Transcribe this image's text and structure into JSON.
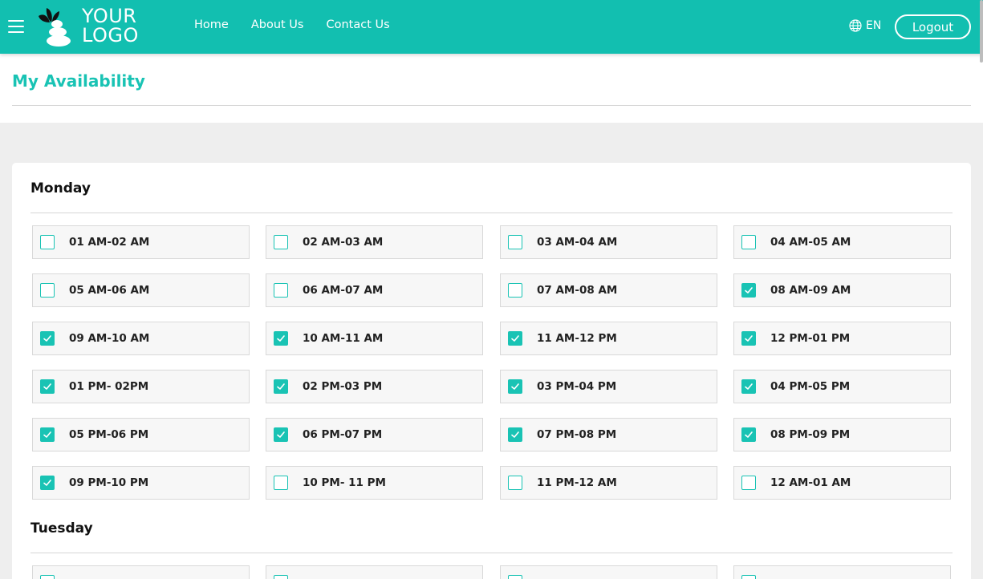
{
  "header": {
    "logo_line1": "YOUR",
    "logo_line2": "LOGO",
    "nav": [
      "Home",
      "About Us",
      "Contact Us"
    ],
    "language": "EN",
    "logout_label": "Logout",
    "brand_color": "#12bfb0"
  },
  "page": {
    "title": "My Availability"
  },
  "days": [
    {
      "name": "Monday",
      "slots": [
        {
          "label": "01 AM-02 AM",
          "checked": false
        },
        {
          "label": "02 AM-03 AM",
          "checked": false
        },
        {
          "label": "03 AM-04 AM",
          "checked": false
        },
        {
          "label": "04 AM-05 AM",
          "checked": false
        },
        {
          "label": "05 AM-06 AM",
          "checked": false
        },
        {
          "label": "06 AM-07 AM",
          "checked": false
        },
        {
          "label": "07 AM-08 AM",
          "checked": false
        },
        {
          "label": "08 AM-09 AM",
          "checked": true
        },
        {
          "label": "09 AM-10 AM",
          "checked": true
        },
        {
          "label": "10 AM-11 AM",
          "checked": true
        },
        {
          "label": "11 AM-12 PM",
          "checked": true
        },
        {
          "label": "12 PM-01 PM",
          "checked": true
        },
        {
          "label": "01 PM- 02PM",
          "checked": true
        },
        {
          "label": "02 PM-03 PM",
          "checked": true
        },
        {
          "label": "03 PM-04 PM",
          "checked": true
        },
        {
          "label": "04 PM-05 PM",
          "checked": true
        },
        {
          "label": "05 PM-06 PM",
          "checked": true
        },
        {
          "label": "06 PM-07 PM",
          "checked": true
        },
        {
          "label": "07 PM-08 PM",
          "checked": true
        },
        {
          "label": "08 PM-09 PM",
          "checked": true
        },
        {
          "label": "09 PM-10 PM",
          "checked": true
        },
        {
          "label": "10 PM- 11 PM",
          "checked": false
        },
        {
          "label": "11 PM-12 AM",
          "checked": false
        },
        {
          "label": "12 AM-01 AM",
          "checked": false
        }
      ]
    },
    {
      "name": "Tuesday",
      "slots": []
    }
  ]
}
